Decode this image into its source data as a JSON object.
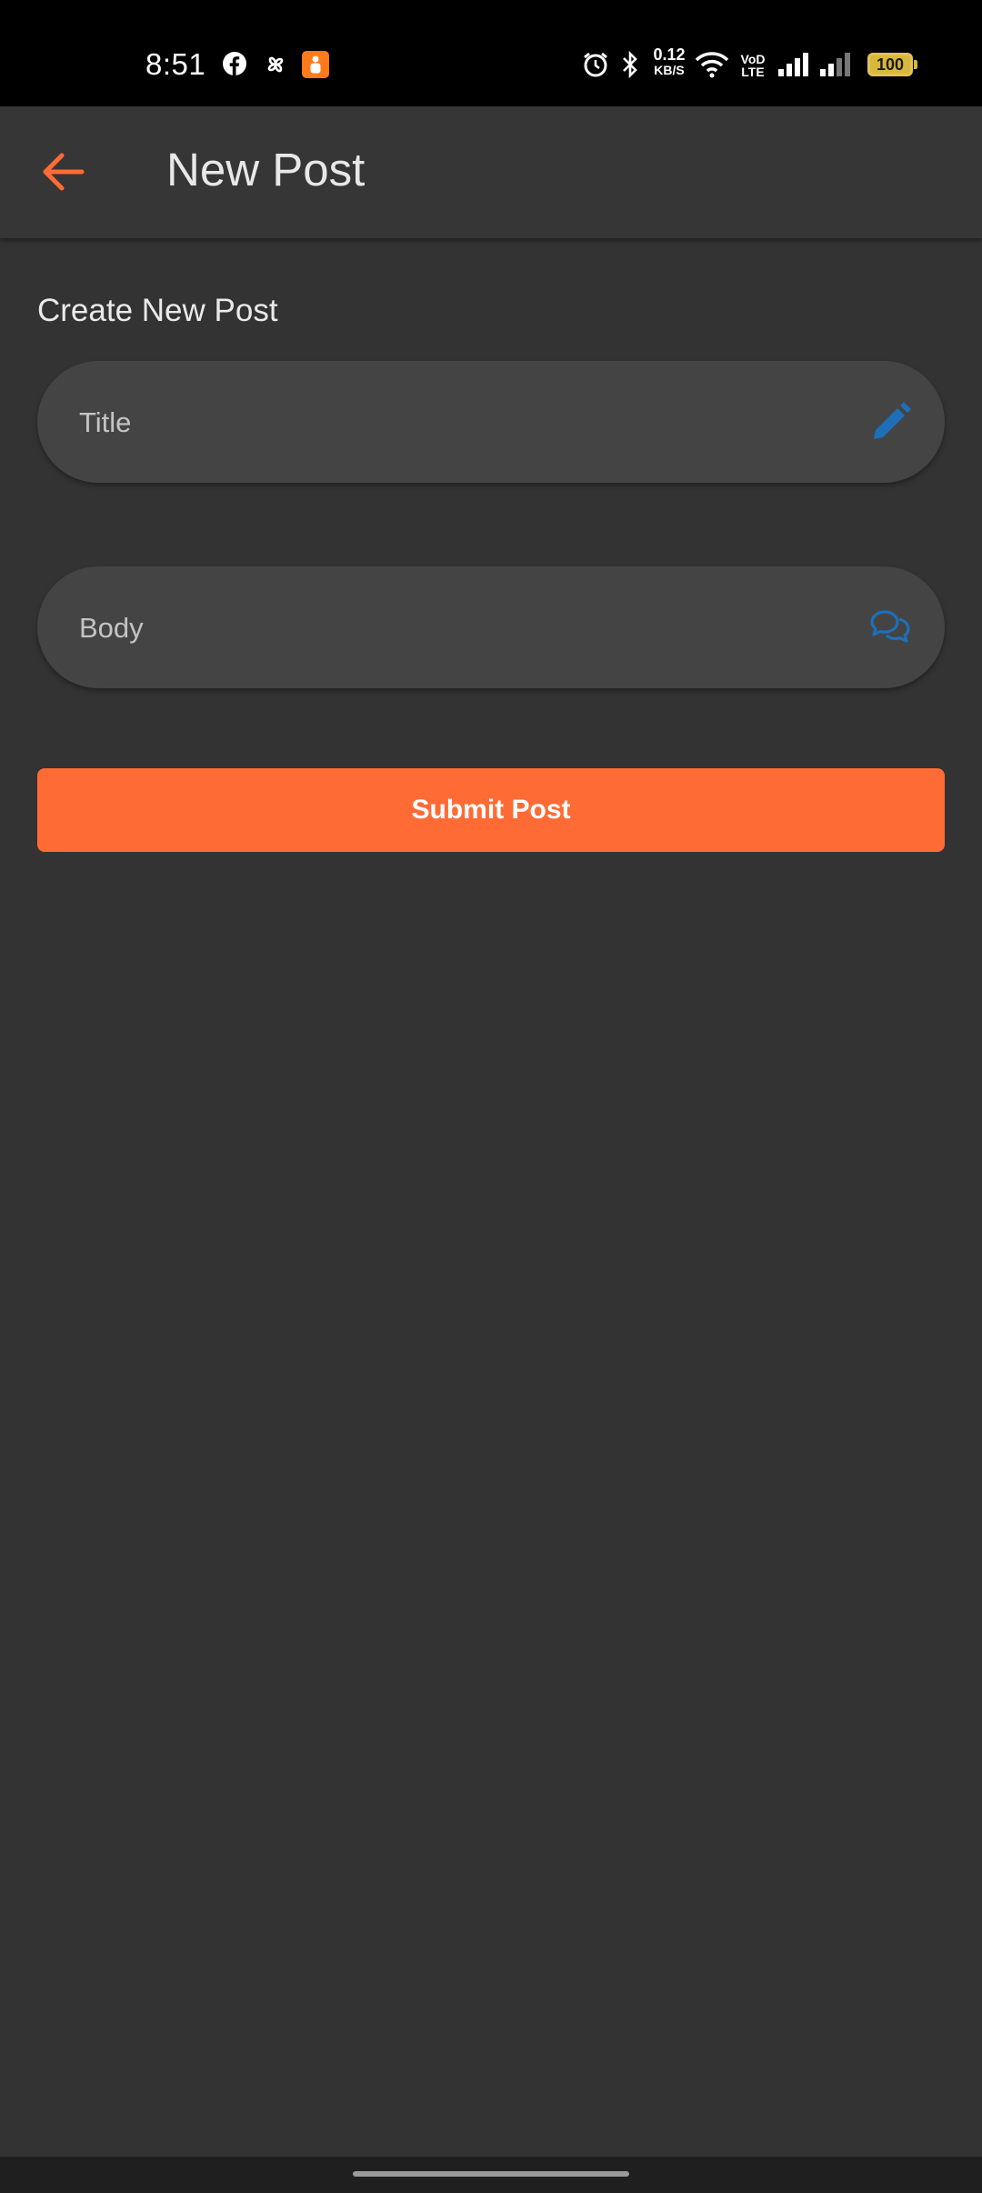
{
  "status_bar": {
    "time": "8:51",
    "net_speed_value": "0.12",
    "net_speed_unit": "KB/S",
    "volte_top": "VoD",
    "volte_bottom": "LTE",
    "battery": "100",
    "icons": [
      "facebook-icon",
      "pinwheel-icon",
      "app-notification-icon",
      "alarm-icon",
      "bluetooth-icon",
      "wifi-icon",
      "signal-icon",
      "signal-icon-2",
      "battery-icon"
    ]
  },
  "app_bar": {
    "title": "New Post",
    "back_icon": "arrow-back-icon"
  },
  "form": {
    "section_label": "Create New Post",
    "title_field": {
      "placeholder": "Title",
      "value": "",
      "icon": "pencil-icon"
    },
    "body_field": {
      "placeholder": "Body",
      "value": "",
      "icon": "chat-bubbles-icon"
    },
    "submit_label": "Submit Post"
  },
  "colors": {
    "accent": "#ff6b35",
    "field_icon": "#1e6fb8",
    "background": "#333333",
    "field_bg": "#444444"
  }
}
